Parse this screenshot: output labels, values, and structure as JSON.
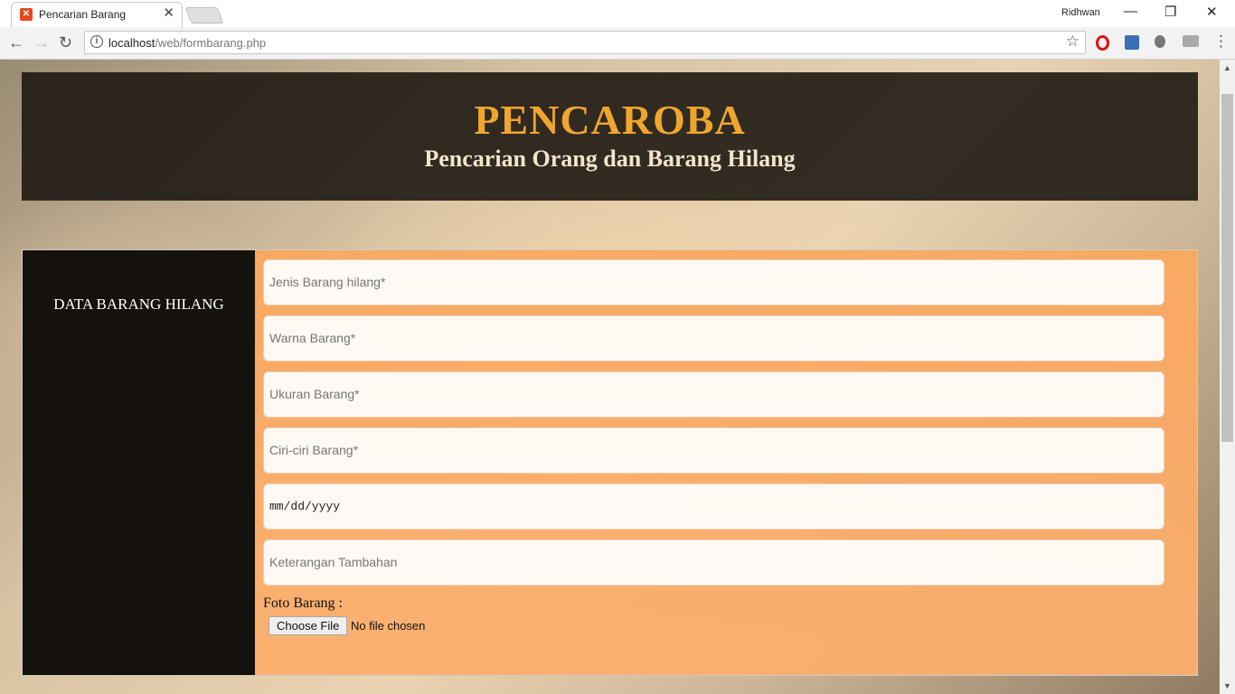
{
  "browser": {
    "tab_title": "Pencarian Barang",
    "tab_close": "✕",
    "profile_name": "Ridhwan",
    "minimize": "—",
    "restore": "❐",
    "close": "✕",
    "url_host": "localhost",
    "url_path": "/web/formbarang.php",
    "icons": [
      "back-icon",
      "forward-icon",
      "reload-icon",
      "info-icon",
      "star-icon",
      "opera-icon",
      "extension-icon",
      "bulb-icon",
      "drive-icon",
      "menu-icon"
    ]
  },
  "header": {
    "title": "PENCAROBA",
    "subtitle": "Pencarian Orang dan Barang Hilang"
  },
  "sidebar": {
    "title": "DATA BARANG HILANG"
  },
  "form": {
    "jenis_placeholder": "Jenis Barang hilang*",
    "warna_placeholder": "Warna Barang*",
    "ukuran_placeholder": "Ukuran Barang*",
    "ciri_placeholder": "Ciri-ciri Barang*",
    "tanggal_placeholder": "mm/dd/yyyy",
    "keterangan_placeholder": "Keterangan Tambahan",
    "foto_label": "Foto Barang :",
    "file_button": "Choose File",
    "file_status": "No file chosen"
  },
  "colors": {
    "title_accent": "#f0a62e",
    "form_bg": "#fba85f",
    "side_bg": "#15120e"
  }
}
